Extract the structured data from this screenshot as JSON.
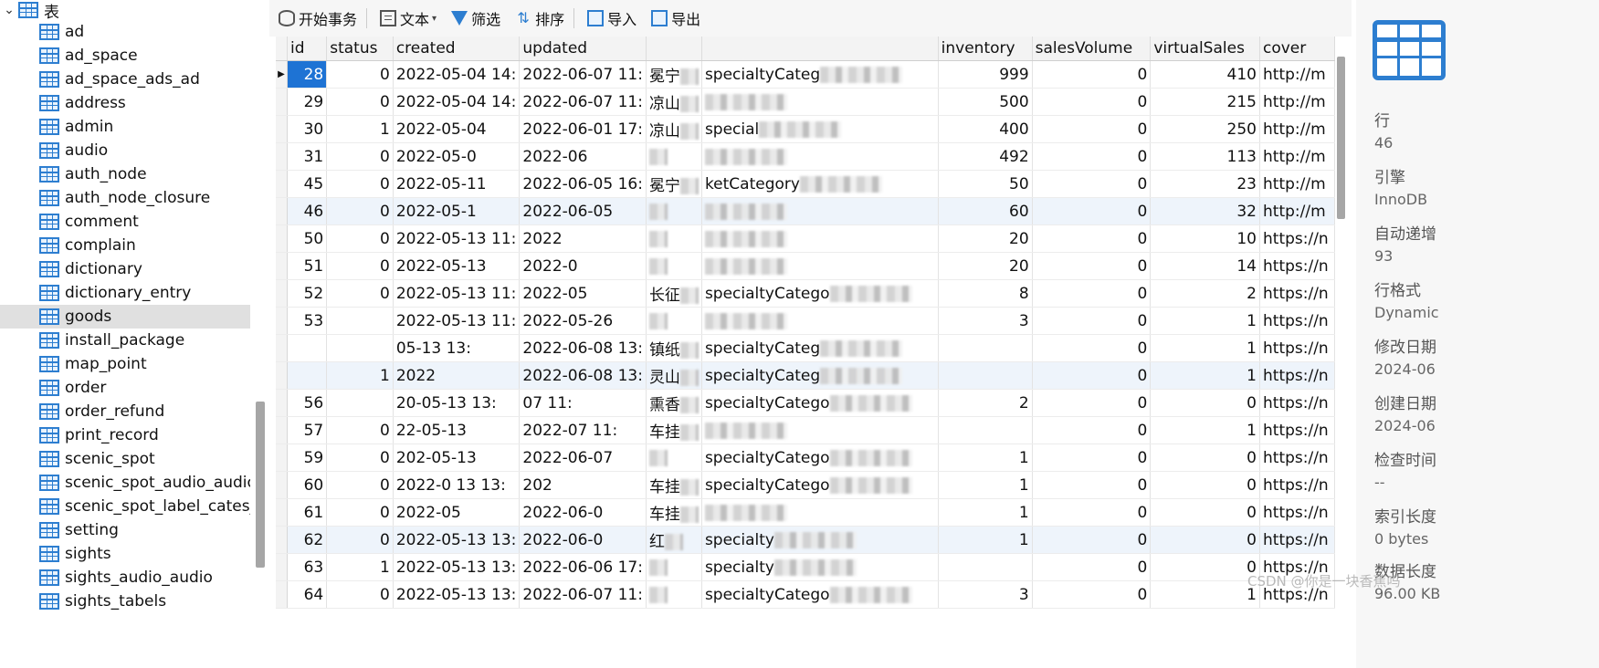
{
  "tree": {
    "root_label": "表",
    "items": [
      "ad",
      "ad_space",
      "ad_space_ads_ad",
      "address",
      "admin",
      "audio",
      "auth_node",
      "auth_node_closure",
      "comment",
      "complain",
      "dictionary",
      "dictionary_entry",
      "goods",
      "install_package",
      "map_point",
      "order",
      "order_refund",
      "print_record",
      "scenic_spot",
      "scenic_spot_audio_audio",
      "scenic_spot_label_cates_sir",
      "setting",
      "sights",
      "sights_audio_audio",
      "sights_tabels"
    ],
    "selected": "goods"
  },
  "toolbar": {
    "begin_tx": "开始事务",
    "text": "文本",
    "filter": "筛选",
    "sort": "排序",
    "import": "导入",
    "export": "导出"
  },
  "grid": {
    "columns": [
      "id",
      "status",
      "created",
      "updated",
      "",
      "",
      "inventory",
      "salesVolume",
      "virtualSales",
      "cover"
    ],
    "rows": [
      {
        "id": "28",
        "status": "0",
        "created": "2022-05-04 14:",
        "updated": "2022-06-07 11:",
        "c5": "冕宁",
        "c6": "specialtyCateg",
        "inventory": "999",
        "salesVolume": "0",
        "virtualSales": "410",
        "cover": "http://m"
      },
      {
        "id": "29",
        "status": "0",
        "created": "2022-05-04 14:",
        "updated": "2022-06-07 11:",
        "c5": "凉山",
        "c6": "",
        "inventory": "500",
        "salesVolume": "0",
        "virtualSales": "215",
        "cover": "http://m"
      },
      {
        "id": "30",
        "status": "1",
        "created": "2022-05-04",
        "updated": "2022-06-01 17:",
        "c5": "凉山",
        "c6": "special",
        "inventory": "400",
        "salesVolume": "0",
        "virtualSales": "250",
        "cover": "http://m"
      },
      {
        "id": "31",
        "status": "0",
        "created": "2022-05-0",
        "updated": "2022-06",
        "c5": "",
        "c6": "",
        "inventory": "492",
        "salesVolume": "0",
        "virtualSales": "113",
        "cover": "http://m"
      },
      {
        "id": "45",
        "status": "0",
        "created": "2022-05-11",
        "updated": "2022-06-05 16:",
        "c5": "冕宁",
        "c6": "ketCategory",
        "inventory": "50",
        "salesVolume": "0",
        "virtualSales": "23",
        "cover": "http://m"
      },
      {
        "id": "46",
        "status": "0",
        "created": "2022-05-1",
        "updated": "2022-06-05",
        "c5": "",
        "c6": "",
        "inventory": "60",
        "salesVolume": "0",
        "virtualSales": "32",
        "cover": "http://m"
      },
      {
        "id": "50",
        "status": "0",
        "created": "2022-05-13 11:",
        "updated": "2022",
        "c5": "",
        "c6": "",
        "inventory": "20",
        "salesVolume": "0",
        "virtualSales": "10",
        "cover": "https://n"
      },
      {
        "id": "51",
        "status": "0",
        "created": "2022-05-13",
        "updated": "2022-0",
        "c5": "",
        "c6": "",
        "inventory": "20",
        "salesVolume": "0",
        "virtualSales": "14",
        "cover": "https://n"
      },
      {
        "id": "52",
        "status": "0",
        "created": "2022-05-13 11:",
        "updated": "2022-05",
        "c5": "长征",
        "c6": "specialtyCatego",
        "inventory": "8",
        "salesVolume": "0",
        "virtualSales": "2",
        "cover": "https://n"
      },
      {
        "id": "53",
        "status": "",
        "created": "2022-05-13 11:",
        "updated": "2022-05-26",
        "c5": "",
        "c6": "",
        "inventory": "3",
        "salesVolume": "0",
        "virtualSales": "1",
        "cover": "https://n"
      },
      {
        "id": "",
        "status": "",
        "created": "05-13 13:",
        "updated": "2022-06-08 13:",
        "c5": "镇纸",
        "c6": "specialtyCateg",
        "inventory": "",
        "salesVolume": "0",
        "virtualSales": "1",
        "cover": "https://n"
      },
      {
        "id": "",
        "status": "1",
        "created": "2022",
        "updated": "2022-06-08 13:",
        "c5": "灵山",
        "c6": "specialtyCateg",
        "inventory": "",
        "salesVolume": "0",
        "virtualSales": "1",
        "cover": "https://n"
      },
      {
        "id": "56",
        "status": "",
        "created": "20-05-13 13:",
        "updated": "07 11:",
        "c5": "熏香",
        "c6": "specialtyCatego",
        "inventory": "2",
        "salesVolume": "0",
        "virtualSales": "0",
        "cover": "https://n"
      },
      {
        "id": "57",
        "status": "0",
        "created": "22-05-13",
        "updated": "2022-07 11:",
        "c5": "车挂",
        "c6": "",
        "inventory": "",
        "salesVolume": "0",
        "virtualSales": "1",
        "cover": "https://n"
      },
      {
        "id": "59",
        "status": "0",
        "created": "202-05-13",
        "updated": "2022-06-07",
        "c5": "",
        "c6": "specialtyCatego",
        "inventory": "1",
        "salesVolume": "0",
        "virtualSales": "0",
        "cover": "https://n"
      },
      {
        "id": "60",
        "status": "0",
        "created": "2022-0 13 13:",
        "updated": "202",
        "c5": "车挂",
        "c6": "specialtyCatego",
        "inventory": "1",
        "salesVolume": "0",
        "virtualSales": "0",
        "cover": "https://n"
      },
      {
        "id": "61",
        "status": "0",
        "created": "2022-05",
        "updated": "2022-06-0",
        "c5": "车挂",
        "c6": "",
        "inventory": "1",
        "salesVolume": "0",
        "virtualSales": "0",
        "cover": "https://n"
      },
      {
        "id": "62",
        "status": "0",
        "created": "2022-05-13 13:",
        "updated": "2022-06-0",
        "c5": "红",
        "c6": "specialty",
        "inventory": "1",
        "salesVolume": "0",
        "virtualSales": "0",
        "cover": "https://n"
      },
      {
        "id": "63",
        "status": "1",
        "created": "2022-05-13 13:",
        "updated": "2022-06-06 17:",
        "c5": "",
        "c6": "specialty",
        "inventory": "",
        "salesVolume": "0",
        "virtualSales": "0",
        "cover": "https://n"
      },
      {
        "id": "64",
        "status": "0",
        "created": "2022-05-13 13:",
        "updated": "2022-06-07 11:",
        "c5": "",
        "c6": "specialtyCatego",
        "inventory": "3",
        "salesVolume": "0",
        "virtualSales": "1",
        "cover": "https://n"
      }
    ]
  },
  "info": {
    "props": [
      {
        "label": "行",
        "value": "46"
      },
      {
        "label": "引擎",
        "value": "InnoDB"
      },
      {
        "label": "自动递增",
        "value": "93"
      },
      {
        "label": "行格式",
        "value": "Dynamic"
      },
      {
        "label": "修改日期",
        "value": "2024-06"
      },
      {
        "label": "创建日期",
        "value": "2024-06"
      },
      {
        "label": "检查时间",
        "value": "--"
      },
      {
        "label": "索引长度",
        "value": "0 bytes"
      },
      {
        "label": "数据长度",
        "value": "96.00 KB"
      }
    ]
  },
  "watermark": "CSDN @你是一块香蕉吗"
}
